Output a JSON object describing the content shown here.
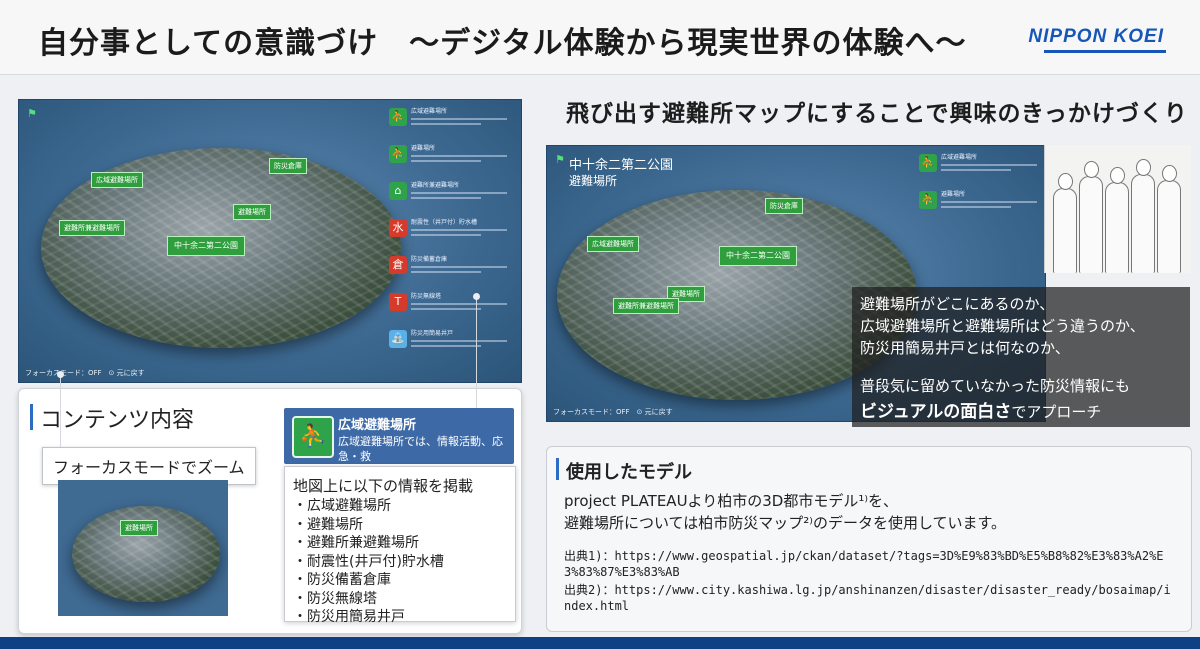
{
  "header": {
    "title": "自分事としての意識づけ　～デジタル体験から現実世界の体験へ～",
    "logo": "NIPPON KOEI"
  },
  "left_game": {
    "status": "フォーカスモード：OFF　⊙ 元に戻す",
    "markers": [
      "広域避難場所",
      "避難所兼避難場所",
      "中十余二第二公園",
      "避難場所",
      "防災倉庫"
    ],
    "legend": [
      {
        "icon": "broad-evacuation-area-icon",
        "label": "広域避難場所",
        "color": "#2fa34a"
      },
      {
        "icon": "evacuation-site-icon",
        "label": "避難場所",
        "color": "#2fa34a"
      },
      {
        "icon": "shelter-icon",
        "label": "避難所兼避難場所",
        "color": "#2fa34a"
      },
      {
        "icon": "water-tank-icon",
        "label": "耐震性（井戸付）貯水槽",
        "color": "#d63a2a"
      },
      {
        "icon": "storehouse-icon",
        "label": "防災備蓄倉庫",
        "color": "#d63a2a"
      },
      {
        "icon": "radio-tower-icon",
        "label": "防災無線塔",
        "color": "#d63a2a"
      },
      {
        "icon": "well-icon",
        "label": "防災用簡易井戸",
        "color": "#5ab0e8"
      }
    ]
  },
  "contents": {
    "title": "コンテンツ内容",
    "focus_tag": "フォーカスモードでズーム",
    "legend_card": {
      "title": "広域避難場所",
      "description": "広域避難場所では、情報活動、応急・救\n援・救護活動を行います"
    },
    "list_header": "地図上に以下の情報を掲載",
    "list_items": [
      "・広域避難場所",
      "・避難場所",
      "・避難所兼避難場所",
      "・耐震性(井戸付)貯水槽",
      "・防災備蓄倉庫",
      "・防災無線塔",
      "・防災用簡易井戸"
    ]
  },
  "right": {
    "heading": "飛び出す避難所マップにすることで興味のきっかけづくり",
    "location_name": "中十余二第二公園",
    "location_type": "避難場所",
    "status": "フォーカスモード：OFF　⊙ 元に戻す",
    "overlay_lines": [
      "避難場所がどこにあるのか、",
      "広域避難場所と避難場所はどう違うのか、",
      "防災用簡易井戸とは何なのか、",
      "普段気に留めていなかった防災情報にも"
    ],
    "overlay_emphasis": "ビジュアルの面白さ",
    "overlay_tail": "でアプローチ"
  },
  "model": {
    "title": "使用したモデル",
    "body_line1": "project PLATEAUより柏市の3D都市モデル¹⁾を、",
    "body_line2": "避難場所については柏市防災マップ²⁾のデータを使用しています。",
    "source1": "出典1)：https://www.geospatial.jp/ckan/dataset/?tags=3D%E9%83%BD%E5%B8%82%E3%83%A2%E3%83%87%E3%83%AB",
    "source2": "出典2)：https://www.city.kashiwa.lg.jp/anshinanzen/disaster/disaster_ready/bosaimap/index.html"
  }
}
